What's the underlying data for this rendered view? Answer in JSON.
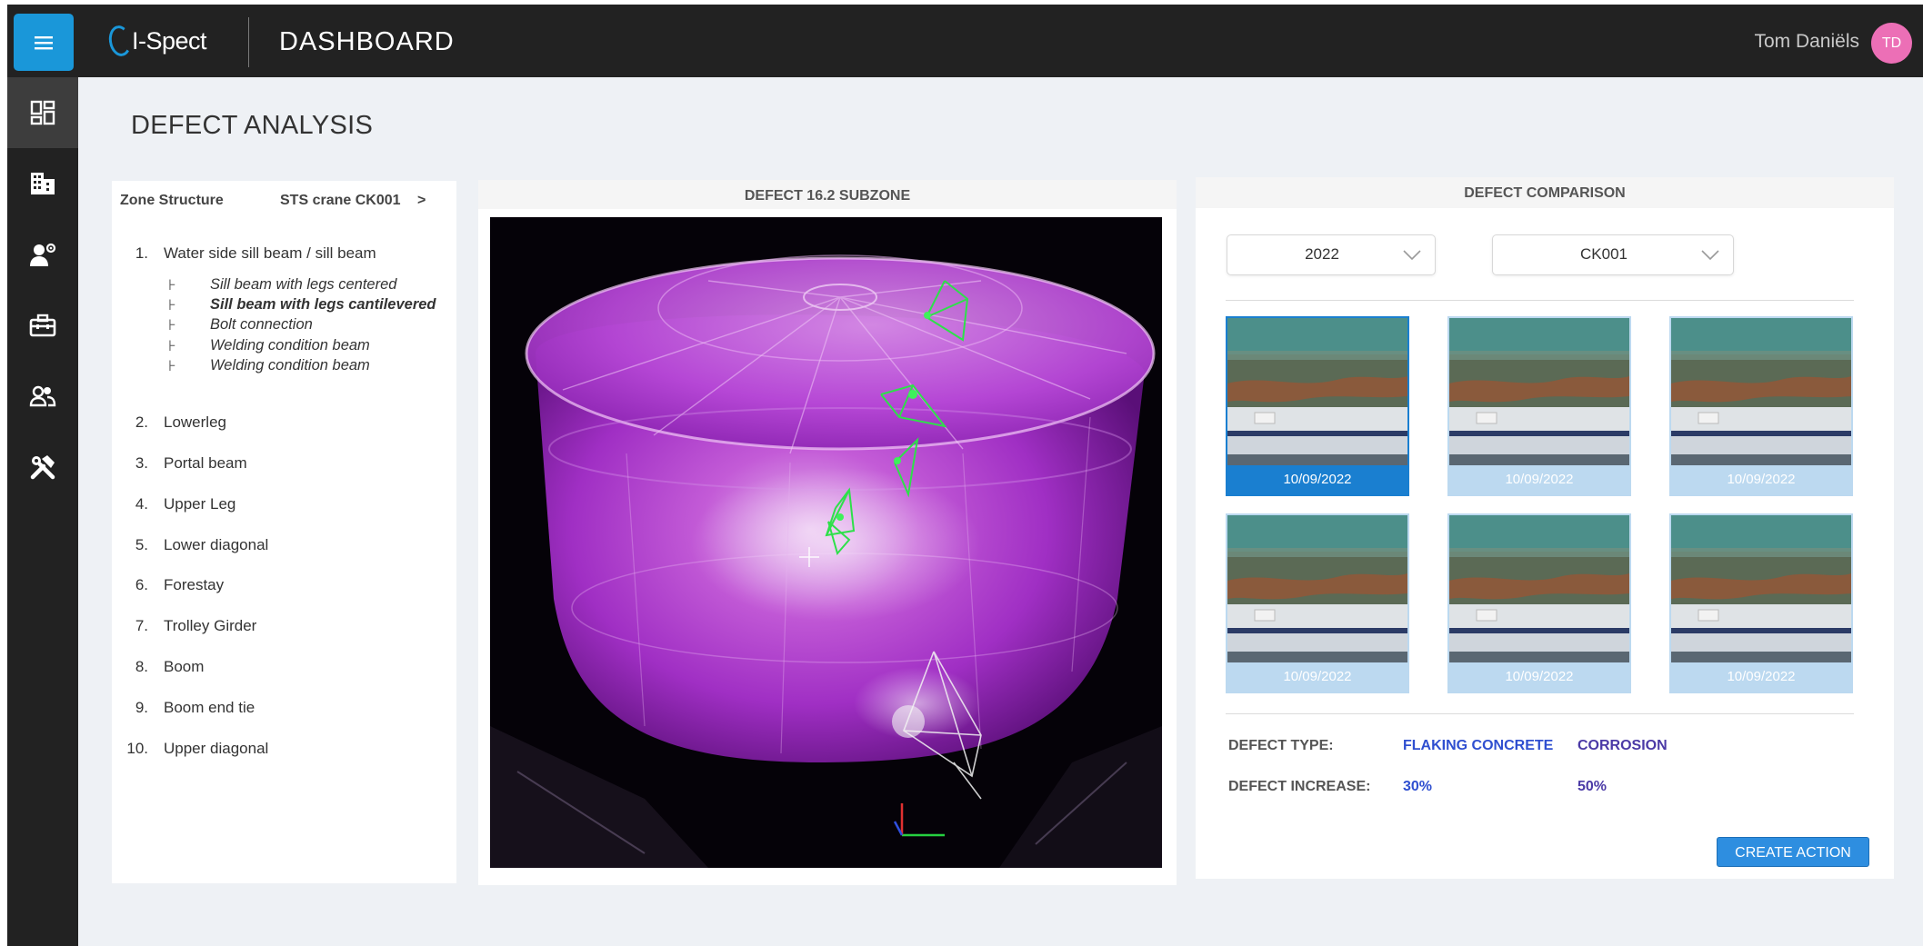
{
  "header": {
    "logo_text": "I-Spect",
    "app_title": "DASHBOARD",
    "user_name": "Tom Daniëls",
    "user_initials": "TD"
  },
  "sidebar": {
    "icons": [
      "dashboard-icon",
      "building-icon",
      "worker-icon",
      "toolbox-icon",
      "team-icon",
      "tools-icon"
    ],
    "active_index": 0
  },
  "page_title": "DEFECT ANALYSIS",
  "zone_panel": {
    "label": "Zone Structure",
    "crane": "STS crane CK001",
    "nav_arrow": ">",
    "items": [
      {
        "num": "1.",
        "label": "Water side sill beam / sill beam"
      },
      {
        "num": "2.",
        "label": "Lowerleg"
      },
      {
        "num": "3.",
        "label": "Portal beam"
      },
      {
        "num": "4.",
        "label": "Upper Leg"
      },
      {
        "num": "5.",
        "label": "Lower diagonal"
      },
      {
        "num": "6.",
        "label": "Forestay"
      },
      {
        "num": "7.",
        "label": "Trolley Girder"
      },
      {
        "num": "8.",
        "label": "Boom"
      },
      {
        "num": "9.",
        "label": "Boom end tie"
      },
      {
        "num": "10.",
        "label": "Upper diagonal"
      }
    ],
    "sub_items": [
      {
        "label": "Sill beam with legs centered",
        "active": false
      },
      {
        "label": "Sill beam with legs cantilevered",
        "active": true
      },
      {
        "label": "Bolt connection",
        "active": false
      },
      {
        "label": "Welding condition beam",
        "active": false
      },
      {
        "label": "Welding condition beam",
        "active": false
      }
    ]
  },
  "defect_view": {
    "title": "DEFECT 16.2 SUBZONE"
  },
  "comparison": {
    "title": "DEFECT COMPARISON",
    "year": "2022",
    "crane": "CK001",
    "thumbnails": [
      {
        "date": "10/09/2022",
        "selected": true
      },
      {
        "date": "10/09/2022",
        "selected": false
      },
      {
        "date": "10/09/2022",
        "selected": false
      },
      {
        "date": "10/09/2022",
        "selected": false
      },
      {
        "date": "10/09/2022",
        "selected": false
      },
      {
        "date": "10/09/2022",
        "selected": false
      }
    ],
    "defect_type_label": "DEFECT TYPE:",
    "defect_types": [
      "FLAKING CONCRETE",
      "CORROSION"
    ],
    "defect_increase_label": "DEFECT INCREASE:",
    "defect_increases": [
      "30%",
      "50%"
    ],
    "create_action_label": "CREATE ACTION"
  },
  "colors": {
    "accent": "#1a97d9",
    "dark": "#222222",
    "avatar": "#ec6fb6",
    "flaking": "#2f4fd0",
    "corrosion": "#4b3aa6"
  }
}
